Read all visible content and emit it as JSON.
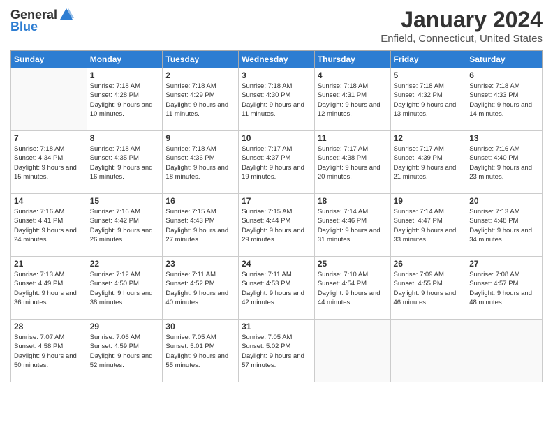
{
  "header": {
    "logo_general": "General",
    "logo_blue": "Blue",
    "month": "January 2024",
    "location": "Enfield, Connecticut, United States"
  },
  "weekdays": [
    "Sunday",
    "Monday",
    "Tuesday",
    "Wednesday",
    "Thursday",
    "Friday",
    "Saturday"
  ],
  "weeks": [
    [
      {
        "day": "",
        "sunrise": "",
        "sunset": "",
        "daylight": ""
      },
      {
        "day": "1",
        "sunrise": "Sunrise: 7:18 AM",
        "sunset": "Sunset: 4:28 PM",
        "daylight": "Daylight: 9 hours and 10 minutes."
      },
      {
        "day": "2",
        "sunrise": "Sunrise: 7:18 AM",
        "sunset": "Sunset: 4:29 PM",
        "daylight": "Daylight: 9 hours and 11 minutes."
      },
      {
        "day": "3",
        "sunrise": "Sunrise: 7:18 AM",
        "sunset": "Sunset: 4:30 PM",
        "daylight": "Daylight: 9 hours and 11 minutes."
      },
      {
        "day": "4",
        "sunrise": "Sunrise: 7:18 AM",
        "sunset": "Sunset: 4:31 PM",
        "daylight": "Daylight: 9 hours and 12 minutes."
      },
      {
        "day": "5",
        "sunrise": "Sunrise: 7:18 AM",
        "sunset": "Sunset: 4:32 PM",
        "daylight": "Daylight: 9 hours and 13 minutes."
      },
      {
        "day": "6",
        "sunrise": "Sunrise: 7:18 AM",
        "sunset": "Sunset: 4:33 PM",
        "daylight": "Daylight: 9 hours and 14 minutes."
      }
    ],
    [
      {
        "day": "7",
        "sunrise": "Sunrise: 7:18 AM",
        "sunset": "Sunset: 4:34 PM",
        "daylight": "Daylight: 9 hours and 15 minutes."
      },
      {
        "day": "8",
        "sunrise": "Sunrise: 7:18 AM",
        "sunset": "Sunset: 4:35 PM",
        "daylight": "Daylight: 9 hours and 16 minutes."
      },
      {
        "day": "9",
        "sunrise": "Sunrise: 7:18 AM",
        "sunset": "Sunset: 4:36 PM",
        "daylight": "Daylight: 9 hours and 18 minutes."
      },
      {
        "day": "10",
        "sunrise": "Sunrise: 7:17 AM",
        "sunset": "Sunset: 4:37 PM",
        "daylight": "Daylight: 9 hours and 19 minutes."
      },
      {
        "day": "11",
        "sunrise": "Sunrise: 7:17 AM",
        "sunset": "Sunset: 4:38 PM",
        "daylight": "Daylight: 9 hours and 20 minutes."
      },
      {
        "day": "12",
        "sunrise": "Sunrise: 7:17 AM",
        "sunset": "Sunset: 4:39 PM",
        "daylight": "Daylight: 9 hours and 21 minutes."
      },
      {
        "day": "13",
        "sunrise": "Sunrise: 7:16 AM",
        "sunset": "Sunset: 4:40 PM",
        "daylight": "Daylight: 9 hours and 23 minutes."
      }
    ],
    [
      {
        "day": "14",
        "sunrise": "Sunrise: 7:16 AM",
        "sunset": "Sunset: 4:41 PM",
        "daylight": "Daylight: 9 hours and 24 minutes."
      },
      {
        "day": "15",
        "sunrise": "Sunrise: 7:16 AM",
        "sunset": "Sunset: 4:42 PM",
        "daylight": "Daylight: 9 hours and 26 minutes."
      },
      {
        "day": "16",
        "sunrise": "Sunrise: 7:15 AM",
        "sunset": "Sunset: 4:43 PM",
        "daylight": "Daylight: 9 hours and 27 minutes."
      },
      {
        "day": "17",
        "sunrise": "Sunrise: 7:15 AM",
        "sunset": "Sunset: 4:44 PM",
        "daylight": "Daylight: 9 hours and 29 minutes."
      },
      {
        "day": "18",
        "sunrise": "Sunrise: 7:14 AM",
        "sunset": "Sunset: 4:46 PM",
        "daylight": "Daylight: 9 hours and 31 minutes."
      },
      {
        "day": "19",
        "sunrise": "Sunrise: 7:14 AM",
        "sunset": "Sunset: 4:47 PM",
        "daylight": "Daylight: 9 hours and 33 minutes."
      },
      {
        "day": "20",
        "sunrise": "Sunrise: 7:13 AM",
        "sunset": "Sunset: 4:48 PM",
        "daylight": "Daylight: 9 hours and 34 minutes."
      }
    ],
    [
      {
        "day": "21",
        "sunrise": "Sunrise: 7:13 AM",
        "sunset": "Sunset: 4:49 PM",
        "daylight": "Daylight: 9 hours and 36 minutes."
      },
      {
        "day": "22",
        "sunrise": "Sunrise: 7:12 AM",
        "sunset": "Sunset: 4:50 PM",
        "daylight": "Daylight: 9 hours and 38 minutes."
      },
      {
        "day": "23",
        "sunrise": "Sunrise: 7:11 AM",
        "sunset": "Sunset: 4:52 PM",
        "daylight": "Daylight: 9 hours and 40 minutes."
      },
      {
        "day": "24",
        "sunrise": "Sunrise: 7:11 AM",
        "sunset": "Sunset: 4:53 PM",
        "daylight": "Daylight: 9 hours and 42 minutes."
      },
      {
        "day": "25",
        "sunrise": "Sunrise: 7:10 AM",
        "sunset": "Sunset: 4:54 PM",
        "daylight": "Daylight: 9 hours and 44 minutes."
      },
      {
        "day": "26",
        "sunrise": "Sunrise: 7:09 AM",
        "sunset": "Sunset: 4:55 PM",
        "daylight": "Daylight: 9 hours and 46 minutes."
      },
      {
        "day": "27",
        "sunrise": "Sunrise: 7:08 AM",
        "sunset": "Sunset: 4:57 PM",
        "daylight": "Daylight: 9 hours and 48 minutes."
      }
    ],
    [
      {
        "day": "28",
        "sunrise": "Sunrise: 7:07 AM",
        "sunset": "Sunset: 4:58 PM",
        "daylight": "Daylight: 9 hours and 50 minutes."
      },
      {
        "day": "29",
        "sunrise": "Sunrise: 7:06 AM",
        "sunset": "Sunset: 4:59 PM",
        "daylight": "Daylight: 9 hours and 52 minutes."
      },
      {
        "day": "30",
        "sunrise": "Sunrise: 7:05 AM",
        "sunset": "Sunset: 5:01 PM",
        "daylight": "Daylight: 9 hours and 55 minutes."
      },
      {
        "day": "31",
        "sunrise": "Sunrise: 7:05 AM",
        "sunset": "Sunset: 5:02 PM",
        "daylight": "Daylight: 9 hours and 57 minutes."
      },
      {
        "day": "",
        "sunrise": "",
        "sunset": "",
        "daylight": ""
      },
      {
        "day": "",
        "sunrise": "",
        "sunset": "",
        "daylight": ""
      },
      {
        "day": "",
        "sunrise": "",
        "sunset": "",
        "daylight": ""
      }
    ]
  ]
}
